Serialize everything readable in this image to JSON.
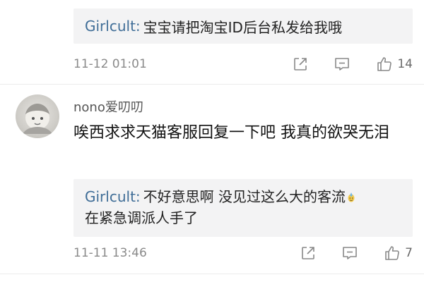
{
  "top_reply": {
    "author": "Girlcult",
    "separator": ":",
    "text": "宝宝请把淘宝ID后台私发给我哦"
  },
  "top_meta": {
    "time": "11-12 01:01",
    "like_count": "14"
  },
  "comment": {
    "username": "nono爱叨叨",
    "text": "唉西求求天猫客服回复一下吧 我真的欲哭无泪",
    "reply": {
      "author": "Girlcult",
      "separator": ":",
      "text_line1": "不好意思啊 没见过这么大的客流",
      "text_line2": "在紧急调派人手了",
      "emoji": "sweat-smile-emoji"
    },
    "time": "11-11 13:46",
    "like_count": "7"
  },
  "icons": {
    "share": "share-icon",
    "comment": "comment-icon",
    "like": "thumbs-up-icon"
  },
  "colors": {
    "reply_name": "#3f6d97",
    "reply_bg": "#f3f3f4",
    "meta_gray": "#8a8a8a"
  }
}
